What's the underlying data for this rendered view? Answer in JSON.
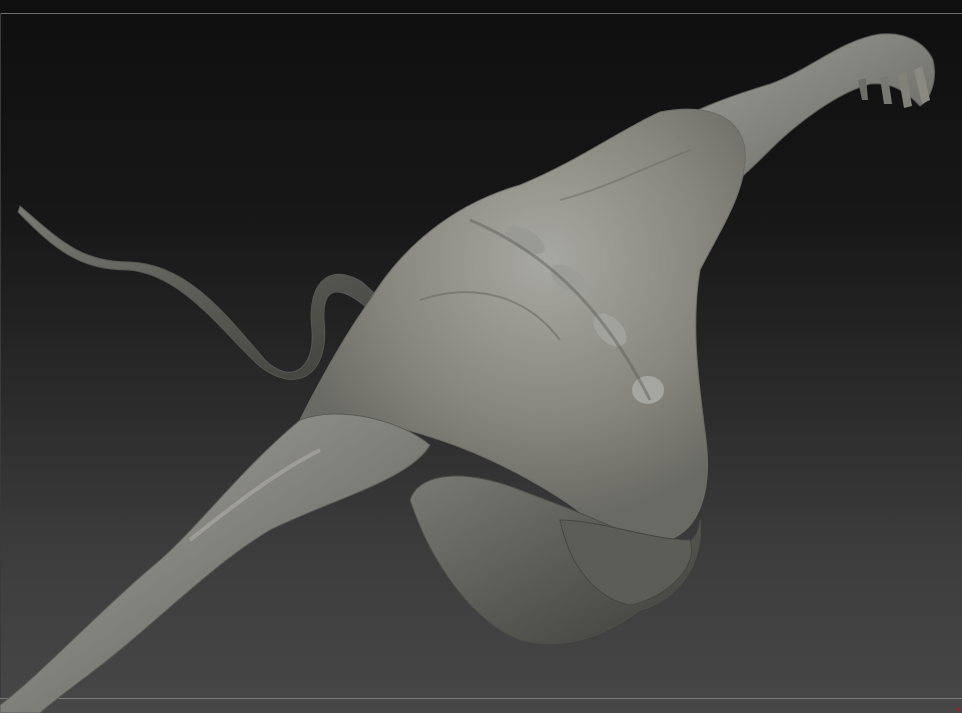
{
  "viewport": {
    "background_top": "#0f0f0f",
    "background_bottom": "#474747",
    "frame_line_color": "#6e6e6e"
  },
  "model": {
    "material_base": "#7d7d78",
    "material_highlight": "#a9a9a3",
    "material_shadow": "#3c3c39",
    "subject": "sculpted-figure"
  },
  "marker_color": "#a81e1e"
}
